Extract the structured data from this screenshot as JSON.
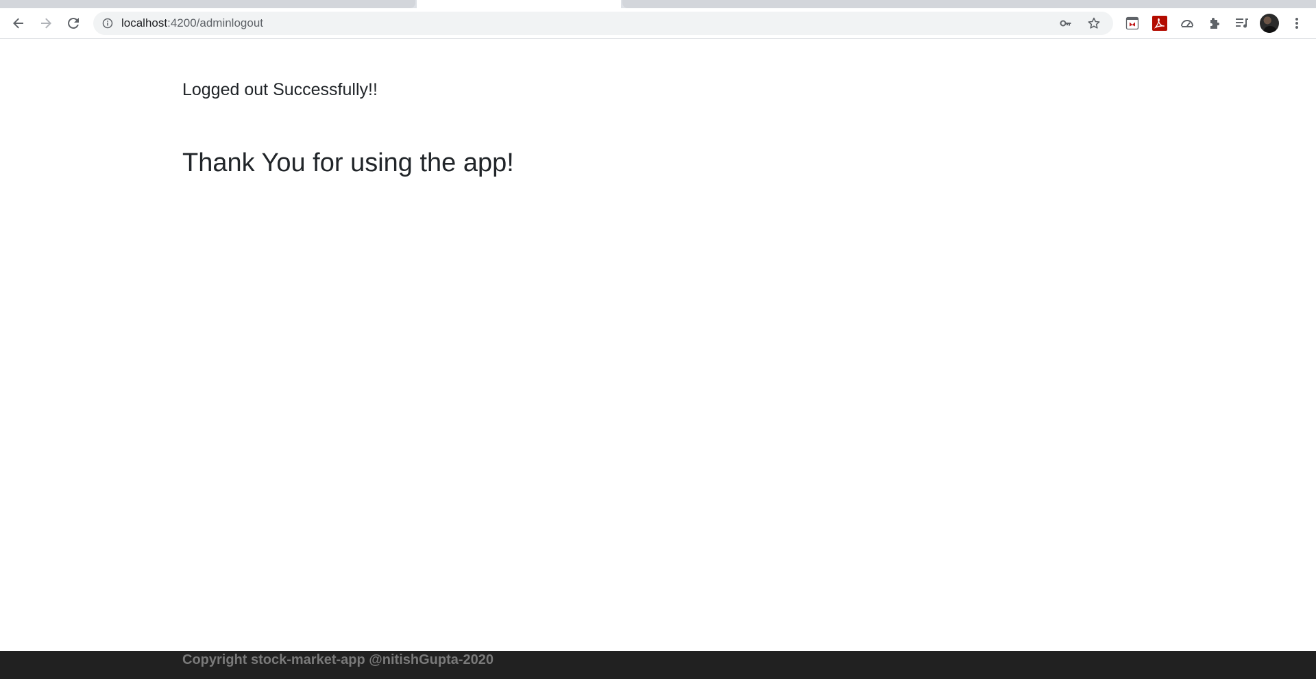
{
  "browser": {
    "address_bar": {
      "host": "localhost",
      "path": ":4200/adminlogout"
    },
    "icons": {
      "back": "back-arrow-icon",
      "forward": "forward-arrow-icon",
      "reload": "reload-icon",
      "site_info": "info-icon",
      "password": "key-icon",
      "bookmark": "star-icon",
      "extensions": [
        "mcafee-icon",
        "pdf-icon",
        "dashboard-icon",
        "puzzle-icon",
        "playlist-icon"
      ],
      "menu": "kebab-menu-icon"
    }
  },
  "page": {
    "message": "Logged out Successfully!!",
    "thanks": "Thank You for using the app!"
  },
  "footer": {
    "copyright": "Copyright stock-market-app @nitishGupta-2020"
  },
  "colors": {
    "footer_bg": "#212121",
    "footer_text": "#7a7a7a",
    "heading_text": "#212529",
    "omnibox_bg": "#f1f3f4"
  }
}
